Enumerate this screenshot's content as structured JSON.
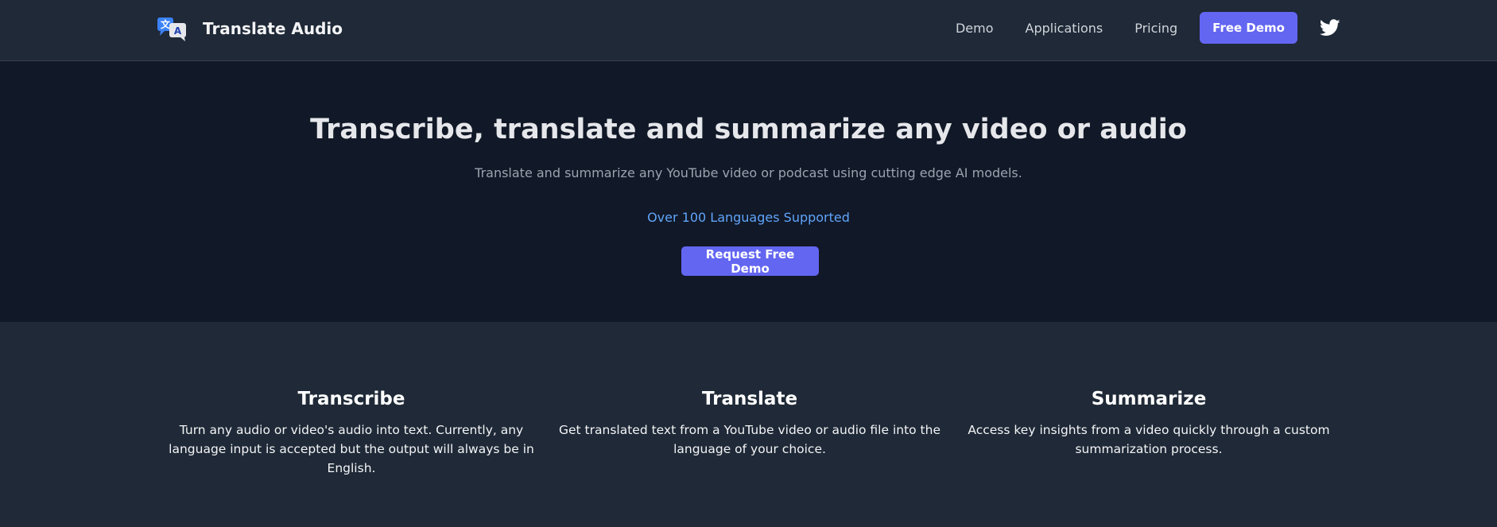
{
  "nav": {
    "brand": "Translate Audio",
    "brand_icon": "translate-icon",
    "links": [
      "Demo",
      "Applications",
      "Pricing"
    ],
    "cta_label": "Free Demo",
    "social_icon": "twitter-icon"
  },
  "hero": {
    "title": "Transcribe, translate and summarize any video or audio",
    "subtitle": "Translate and summarize any YouTube video or podcast using cutting edge AI models.",
    "languages": "Over 100 Languages Supported",
    "cta_label": "Request Free Demo"
  },
  "features": [
    {
      "title": "Transcribe",
      "description": "Turn any audio or video's audio into text. Currently, any language input is accepted but the output will always be in English."
    },
    {
      "title": "Translate",
      "description": "Get translated text from a YouTube video or audio file into the language of your choice."
    },
    {
      "title": "Summarize",
      "description": "Access key insights from a video quickly through a custom summarization process."
    }
  ],
  "colors": {
    "accent": "#6366f1",
    "nav_bg": "#1f2937",
    "hero_bg": "#111827",
    "link_blue": "#60a5fa"
  }
}
